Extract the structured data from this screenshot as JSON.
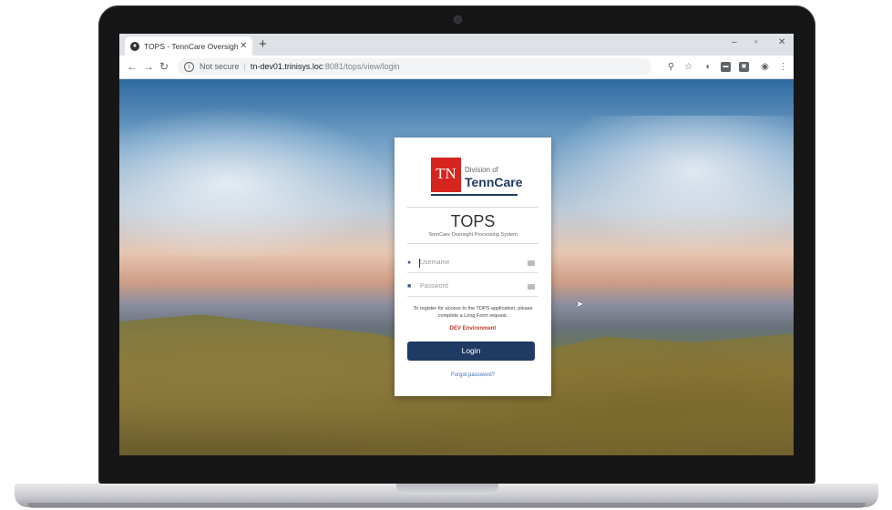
{
  "browser": {
    "tab_title": "TOPS - TennCare Oversight Proc",
    "new_tab_label": "+",
    "window_controls": {
      "minimize": "–",
      "restore": "▫",
      "close": "✕"
    },
    "security_label": "Not secure",
    "url_host": "tn-dev01.trinisys.loc",
    "url_path": ":8081/tops/view/login"
  },
  "login": {
    "logo_text": "TN",
    "logo_division": "Division of",
    "logo_name": "TennCare",
    "app_title": "TOPS",
    "app_subtitle": "TennCare Oversight Processing System",
    "username_placeholder": "Username",
    "password_placeholder": "Password",
    "register_text_1": "To register for access to the TOPS application, please",
    "register_text_2": "complete a Long Form request.",
    "environment_label": "DEV Environment",
    "login_button": "Login",
    "forgot_password": "Forgot password?"
  },
  "colors": {
    "brand_navy": "#1f3a63",
    "brand_red": "#d6251f",
    "env_red": "#c0392b",
    "link_blue": "#3b6fb6"
  },
  "icons": [
    "chrome-favicon",
    "back-arrow-icon",
    "forward-arrow-icon",
    "reload-icon",
    "info-icon",
    "zoom-icon",
    "star-icon",
    "extension-icon",
    "profile-icon",
    "menu-icon",
    "user-icon",
    "lock-icon",
    "key-icon"
  ]
}
